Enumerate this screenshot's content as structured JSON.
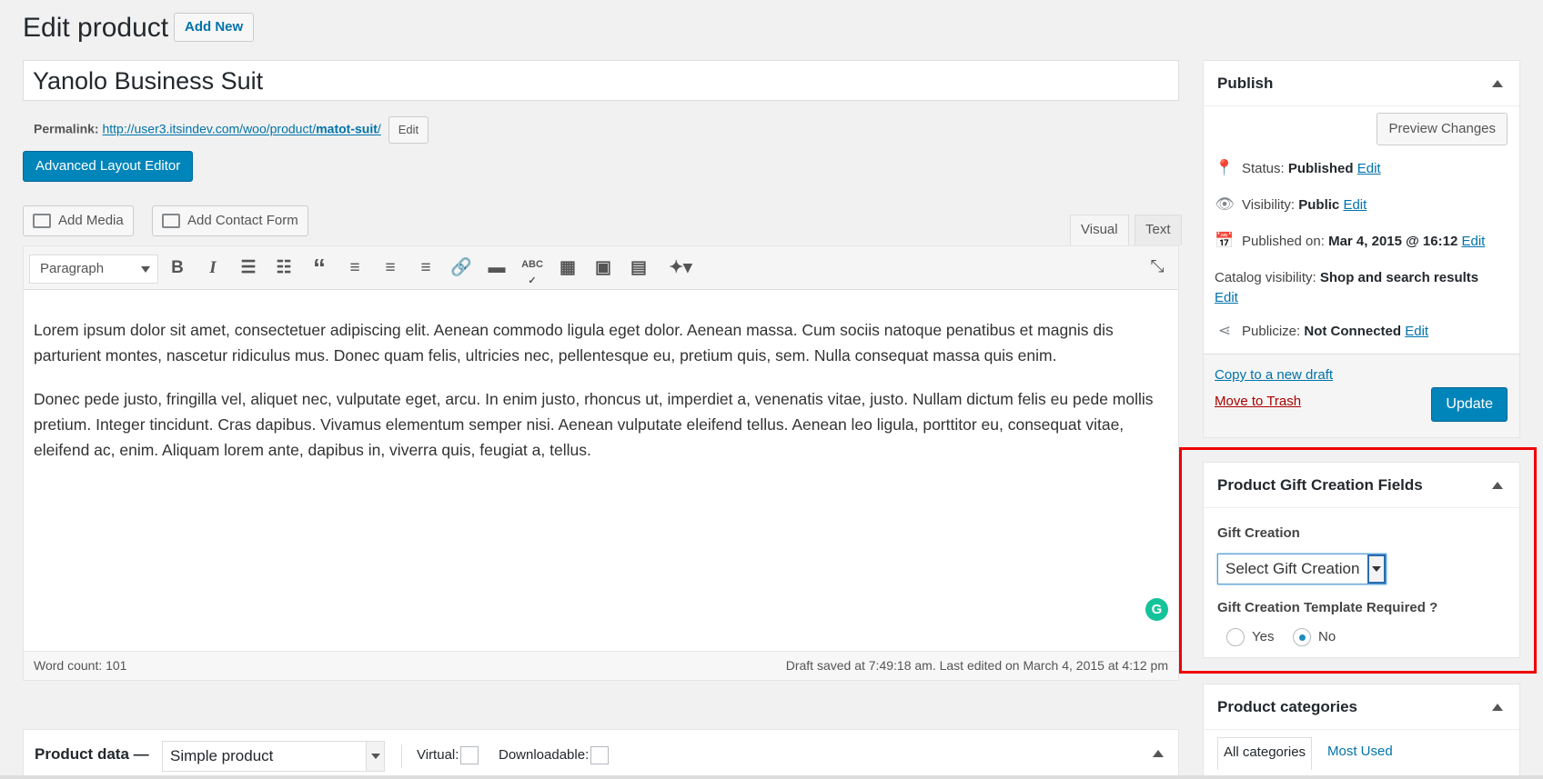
{
  "header": {
    "title": "Edit product",
    "add_new": "Add New"
  },
  "post": {
    "title": "Yanolo Business Suit",
    "permalink_label": "Permalink:",
    "permalink_base": "http://user3.itsindev.com/woo/product/",
    "permalink_slug": "matot-suit",
    "permalink_tail": "/",
    "permalink_edit": "Edit",
    "advanced_layout_editor": "Advanced Layout Editor"
  },
  "media": {
    "add_media": "Add Media",
    "add_contact_form": "Add Contact Form"
  },
  "editor": {
    "tab_visual": "Visual",
    "tab_text": "Text",
    "format_select": "Paragraph",
    "paragraphs": [
      "Lorem ipsum dolor sit amet, consectetuer adipiscing elit. Aenean commodo ligula eget dolor. Aenean massa. Cum sociis natoque penatibus et magnis dis parturient montes, nascetur ridiculus mus. Donec quam felis, ultricies nec, pellentesque eu, pretium quis, sem. Nulla consequat massa quis enim.",
      "Donec pede justo, fringilla vel, aliquet nec, vulputate eget, arcu. In enim justo, rhoncus ut, imperdiet a, venenatis vitae, justo. Nullam dictum felis eu pede mollis pretium. Integer tincidunt. Cras dapibus. Vivamus elementum semper nisi. Aenean vulputate eleifend tellus. Aenean leo ligula, porttitor eu, consequat vitae, eleifend ac, enim. Aliquam lorem ante, dapibus in, viverra quis, feugiat a, tellus."
    ],
    "word_count": "Word count: 101",
    "draft_status": "Draft saved at 7:49:18 am. Last edited on March 4, 2015 at 4:12 pm",
    "toolbar_icons": [
      "bold-icon",
      "italic-icon",
      "bullet-list-icon",
      "numbered-list-icon",
      "blockquote-icon",
      "align-left-icon",
      "align-center-icon",
      "align-right-icon",
      "link-icon",
      "read-more-icon",
      "spellcheck-icon",
      "toolbar-toggle-icon",
      "gallery-icon",
      "form-icon",
      "wand-icon",
      "fullscreen-icon"
    ]
  },
  "product_data": {
    "label": "Product data —",
    "type": "Simple product",
    "virtual": "Virtual:",
    "downloadable": "Downloadable:"
  },
  "publish": {
    "title": "Publish",
    "preview": "Preview Changes",
    "status_label": "Status:",
    "status_value": "Published",
    "status_edit": "Edit",
    "visibility_label": "Visibility:",
    "visibility_value": "Public",
    "visibility_edit": "Edit",
    "published_label": "Published on:",
    "published_value": "Mar 4, 2015 @ 16:12",
    "published_edit": "Edit",
    "catalog_label": "Catalog visibility:",
    "catalog_value": "Shop and search results",
    "catalog_edit": "Edit",
    "publicize_label": "Publicize:",
    "publicize_value": "Not Connected",
    "publicize_edit": "Edit",
    "copy_draft": "Copy to a new draft",
    "trash": "Move to Trash",
    "update": "Update"
  },
  "gift": {
    "title": "Product Gift Creation Fields",
    "label": "Gift Creation",
    "select": "Select Gift Creation",
    "template_label": "Gift Creation Template Required ?",
    "yes": "Yes",
    "no": "No",
    "selected": "No"
  },
  "categories": {
    "title": "Product categories",
    "all": "All categories",
    "most_used": "Most Used"
  },
  "colors": {
    "primary": "#0085ba",
    "link": "#0073aa",
    "trash": "#aa0000",
    "highlight": "#ee0000"
  }
}
